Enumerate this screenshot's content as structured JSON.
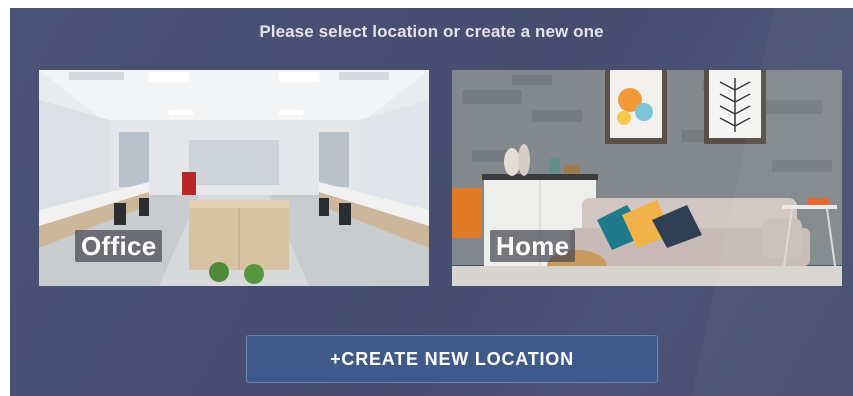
{
  "prompt": "Please select location or create a new one",
  "locations": [
    {
      "label": "Office"
    },
    {
      "label": "Home"
    }
  ],
  "create_button": "+CREATE NEW LOCATION",
  "colors": {
    "panel_bg": "#474e72",
    "button_bg": "#3f5a8a",
    "prompt_text": "#e2e3ea"
  }
}
